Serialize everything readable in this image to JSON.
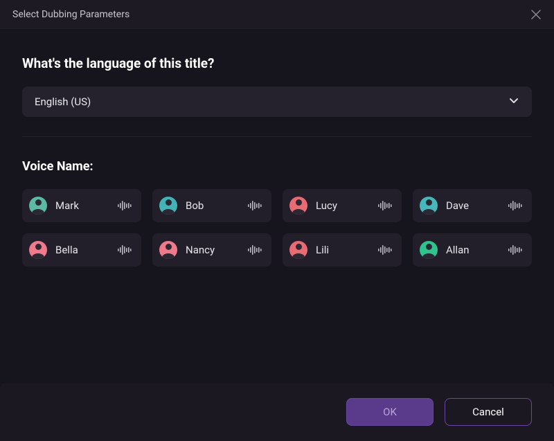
{
  "titlebar": {
    "title": "Select Dubbing Parameters"
  },
  "language": {
    "heading": "What's the language of this title?",
    "selected": "English (US)"
  },
  "voice": {
    "section_label": "Voice Name:",
    "items": [
      {
        "name": "Mark",
        "avatar_color": "#5bb9a4"
      },
      {
        "name": "Bob",
        "avatar_color": "#44b3b8"
      },
      {
        "name": "Lucy",
        "avatar_color": "#e86a72"
      },
      {
        "name": "Dave",
        "avatar_color": "#47b7bc"
      },
      {
        "name": "Bella",
        "avatar_color": "#ef7a8b"
      },
      {
        "name": "Nancy",
        "avatar_color": "#ef7a8b"
      },
      {
        "name": "Lili",
        "avatar_color": "#e86a72"
      },
      {
        "name": "Allan",
        "avatar_color": "#2fc48e"
      }
    ]
  },
  "footer": {
    "ok_label": "OK",
    "cancel_label": "Cancel"
  }
}
